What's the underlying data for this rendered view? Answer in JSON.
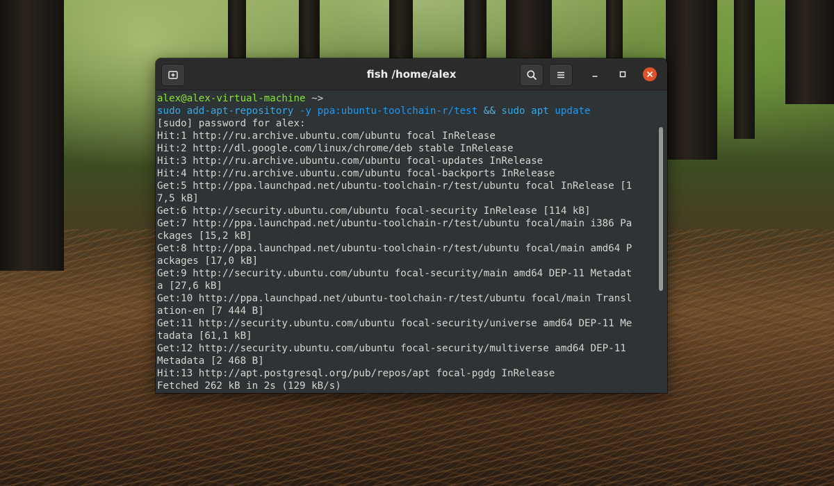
{
  "window": {
    "title": "fish /home/alex",
    "accent_close": "#e0532a"
  },
  "icons": {
    "new_tab": "new-tab-icon",
    "search": "search-icon",
    "menu": "hamburger-menu-icon",
    "minimize": "minimize-icon",
    "maximize": "maximize-icon",
    "close": "close-icon"
  },
  "prompt": {
    "user_host": "alex@alex-virtual-machine",
    "cwd": " ~>"
  },
  "command": {
    "part1": "sudo",
    "part2": " add-apt-repository",
    "part3": " -y",
    "part4": " ppa:ubuntu-toolchain-r/test",
    "part5": " &&",
    "part6": " sudo",
    "part7": " apt",
    "part8": " update"
  },
  "output": [
    "[sudo] password for alex:",
    "Hit:1 http://ru.archive.ubuntu.com/ubuntu focal InRelease",
    "Hit:2 http://dl.google.com/linux/chrome/deb stable InRelease",
    "Hit:3 http://ru.archive.ubuntu.com/ubuntu focal-updates InRelease",
    "Hit:4 http://ru.archive.ubuntu.com/ubuntu focal-backports InRelease",
    "Get:5 http://ppa.launchpad.net/ubuntu-toolchain-r/test/ubuntu focal InRelease [1",
    "7,5 kB]",
    "Get:6 http://security.ubuntu.com/ubuntu focal-security InRelease [114 kB]",
    "Get:7 http://ppa.launchpad.net/ubuntu-toolchain-r/test/ubuntu focal/main i386 Pa",
    "ckages [15,2 kB]",
    "Get:8 http://ppa.launchpad.net/ubuntu-toolchain-r/test/ubuntu focal/main amd64 P",
    "ackages [17,0 kB]",
    "Get:9 http://security.ubuntu.com/ubuntu focal-security/main amd64 DEP-11 Metadat",
    "a [27,6 kB]",
    "Get:10 http://ppa.launchpad.net/ubuntu-toolchain-r/test/ubuntu focal/main Transl",
    "ation-en [7 444 B]",
    "Get:11 http://security.ubuntu.com/ubuntu focal-security/universe amd64 DEP-11 Me",
    "tadata [61,1 kB]",
    "Get:12 http://security.ubuntu.com/ubuntu focal-security/multiverse amd64 DEP-11",
    "Metadata [2 468 B]",
    "Hit:13 http://apt.postgresql.org/pub/repos/apt focal-pgdg InRelease",
    "Fetched 262 kB in 2s (129 kB/s)"
  ]
}
